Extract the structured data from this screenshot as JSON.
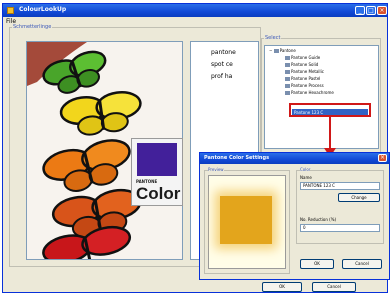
{
  "window": {
    "title": "ColourLookUp"
  },
  "menu": {
    "file": "File"
  },
  "preview_panel": {
    "label": "Schmetterlinge",
    "brand_small": "PANTONE",
    "brand_big": "Color"
  },
  "list_items": [
    "pantone",
    "spot ce",
    "prof ha"
  ],
  "tree_panel": {
    "label": "Select",
    "root": "Pantone",
    "nodes": [
      "Pantone Guide",
      "Pantone Solid",
      "Pantone Metallic",
      "Pantone Pastel",
      "Pantone Process",
      "Pantone Hexachrome",
      "Pantone 123 C"
    ],
    "selected": "Pantone 123 C"
  },
  "dialog": {
    "title": "Pantone Color Settings",
    "preview_label": "Preview",
    "color_group": "Color",
    "name_label": "Name",
    "name_value": "PANTONE 123 C",
    "change_button": "Change",
    "no_label": "No. Reduction (%)",
    "no_value": "0",
    "ok_button": "OK",
    "cancel_button": "Cancel",
    "swatch_color": "#e3a51c"
  },
  "footer": {
    "ok": "OK",
    "cancel": "Cancel"
  },
  "colors": {
    "accent": "#0831d9",
    "highlight": "#d01818",
    "purple": "#42209a"
  }
}
